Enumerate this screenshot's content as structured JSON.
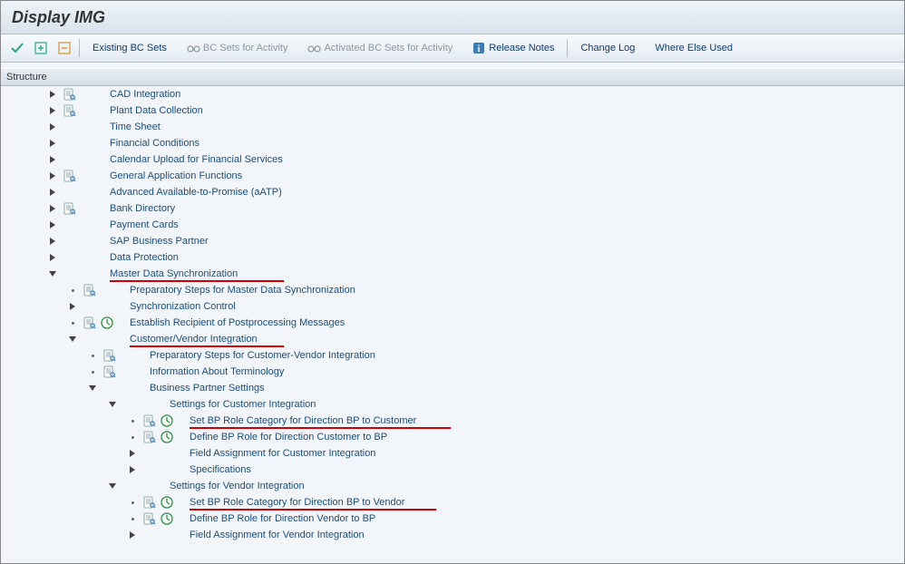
{
  "title": "Display IMG",
  "toolbar": {
    "existing_bc_sets": "Existing BC Sets",
    "bc_sets_activity": "BC Sets for Activity",
    "activated_bc_sets": "Activated BC Sets for Activity",
    "release_notes": "Release Notes",
    "change_log": "Change Log",
    "where_else_used": "Where Else Used"
  },
  "panel_header": "Structure",
  "tree": [
    {
      "indent": 0,
      "toggle": "r",
      "doc": true,
      "label": "CAD Integration"
    },
    {
      "indent": 0,
      "toggle": "r",
      "doc": true,
      "label": "Plant Data Collection"
    },
    {
      "indent": 0,
      "toggle": "r",
      "label": "Time Sheet"
    },
    {
      "indent": 0,
      "toggle": "r",
      "label": "Financial Conditions"
    },
    {
      "indent": 0,
      "toggle": "r",
      "label": "Calendar Upload for Financial Services"
    },
    {
      "indent": 0,
      "toggle": "r",
      "doc": true,
      "label": "General Application Functions"
    },
    {
      "indent": 0,
      "toggle": "r",
      "label": "Advanced Available-to-Promise (aATP)"
    },
    {
      "indent": 0,
      "toggle": "r",
      "doc": true,
      "label": "Bank Directory"
    },
    {
      "indent": 0,
      "toggle": "r",
      "label": "Payment Cards"
    },
    {
      "indent": 0,
      "toggle": "r",
      "label": "SAP Business Partner"
    },
    {
      "indent": 0,
      "toggle": "r",
      "label": "Data Protection"
    },
    {
      "indent": 0,
      "toggle": "d",
      "label": "Master Data Synchronization",
      "redline": true,
      "redline_width": 192
    },
    {
      "indent": 1,
      "toggle": "dot",
      "doc": true,
      "label": "Preparatory Steps for Master Data Synchronization"
    },
    {
      "indent": 1,
      "toggle": "r",
      "label": "Synchronization Control"
    },
    {
      "indent": 1,
      "toggle": "dot",
      "doc": true,
      "exec": true,
      "label": "Establish Recipient of Postprocessing Messages"
    },
    {
      "indent": 1,
      "toggle": "d",
      "label": "Customer/Vendor Integration",
      "redline": true,
      "redline_width": 170
    },
    {
      "indent": 2,
      "toggle": "dot",
      "doc": true,
      "label": "Preparatory Steps for Customer-Vendor Integration"
    },
    {
      "indent": 2,
      "toggle": "dot",
      "doc": true,
      "label": "Information About Terminology"
    },
    {
      "indent": 2,
      "toggle": "d",
      "label": "Business Partner Settings"
    },
    {
      "indent": 3,
      "toggle": "d",
      "label": "Settings for Customer Integration"
    },
    {
      "indent": 4,
      "toggle": "dot",
      "doc": true,
      "exec": true,
      "label": "Set BP Role Category for Direction BP to Customer",
      "redline": true,
      "redline_width": 288
    },
    {
      "indent": 4,
      "toggle": "dot",
      "doc": true,
      "exec": true,
      "label": "Define BP Role for Direction Customer to BP"
    },
    {
      "indent": 4,
      "toggle": "r",
      "label": "Field Assignment for Customer Integration"
    },
    {
      "indent": 4,
      "toggle": "r",
      "label": "Specifications"
    },
    {
      "indent": 3,
      "toggle": "d",
      "label": "Settings for Vendor Integration"
    },
    {
      "indent": 4,
      "toggle": "dot",
      "doc": true,
      "exec": true,
      "label": "Set BP Role Category for Direction BP to Vendor",
      "redline": true,
      "redline_width": 272
    },
    {
      "indent": 4,
      "toggle": "dot",
      "doc": true,
      "exec": true,
      "label": "Define BP Role for Direction Vendor to BP"
    },
    {
      "indent": 4,
      "toggle": "r",
      "label": "Field Assignment for Vendor Integration"
    }
  ],
  "layout": {
    "base_indent": 52,
    "indent_step": 22,
    "label_offset": 120
  }
}
